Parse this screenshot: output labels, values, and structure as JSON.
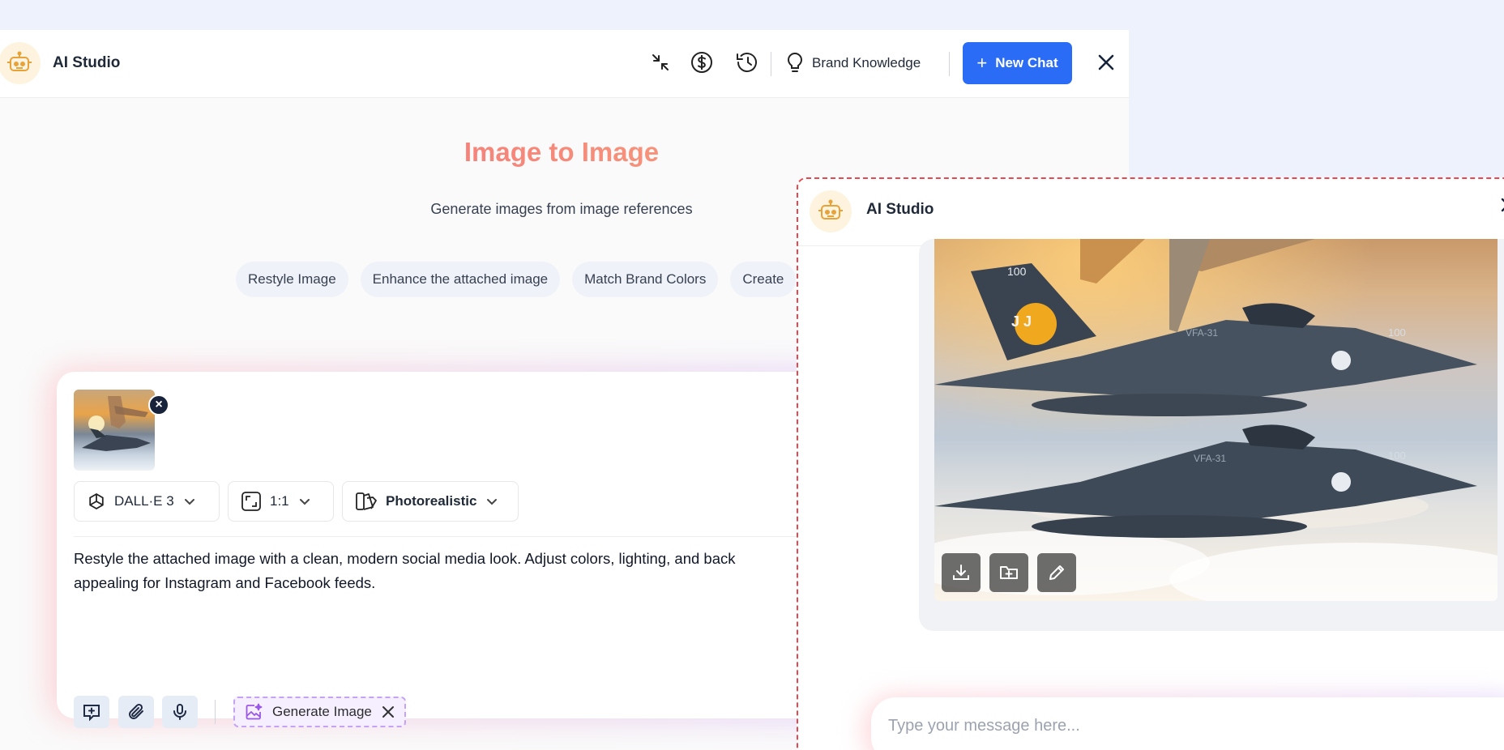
{
  "app": {
    "title": "AI Studio"
  },
  "header": {
    "brand_knowledge_label": "Brand Knowledge",
    "new_chat_label": "New Chat",
    "icons": [
      "minimize-icon",
      "dollar-icon",
      "history-icon",
      "lightbulb-icon",
      "close-icon"
    ]
  },
  "hero": {
    "title_part1": "Image to",
    "title_part2": "Image",
    "subtitle": "Generate images from image references",
    "chips": [
      "Restyle Image",
      "Enhance the attached image",
      "Match Brand Colors",
      "Create"
    ]
  },
  "composer": {
    "model": "DALL·E 3",
    "ratio": "1:1",
    "style": "Photorealistic",
    "prompt_line1": "Restyle the attached image with a clean, modern social media look. Adjust colors, lighting, and back",
    "prompt_line2": "appealing for Instagram and Facebook feeds.",
    "generate_label": "Generate Image"
  },
  "popup": {
    "title": "AI Studio",
    "message_placeholder": "Type your message here...",
    "image_labels": {
      "unit": "VFA-31",
      "number": "100",
      "tail": "J J"
    }
  },
  "colors": {
    "accent": "#2b6cf6",
    "heading_gradient": [
      "#f25f7a",
      "#f9bb79"
    ],
    "generate_border": "#c4a2f5",
    "popup_border": "#e8474f"
  }
}
